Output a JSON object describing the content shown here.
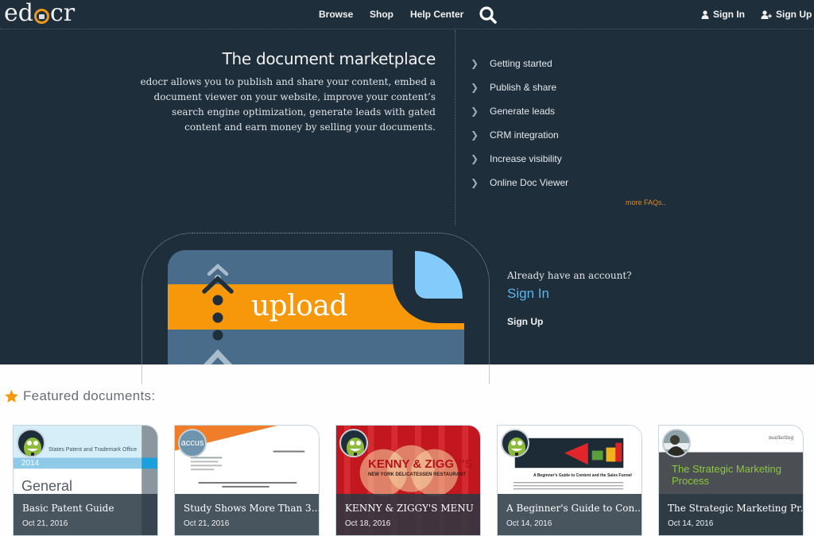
{
  "header": {
    "logo": {
      "prefix": "ed",
      "suffix": "cr"
    },
    "nav": [
      {
        "label": "Browse"
      },
      {
        "label": "Shop"
      },
      {
        "label": "Help Center"
      }
    ],
    "search_icon": "search-icon",
    "signin_label": "Sign In",
    "signup_label": "Sign Up"
  },
  "hero": {
    "headline": "The document marketplace",
    "description": "edocr allows you to publish and share your content, embed a document viewer on your website, improve your content’s search engine optimization, generate leads with gated content and earn money by selling your documents.",
    "faqs": [
      {
        "label": "Getting started"
      },
      {
        "label": "Publish & share"
      },
      {
        "label": "Generate leads"
      },
      {
        "label": "CRM integration"
      },
      {
        "label": "Increase visibility"
      },
      {
        "label": "Online Doc Viewer"
      }
    ],
    "more_faqs": "more FAQs..",
    "upload_label": "upload",
    "account": {
      "question": "Already have an account?",
      "signin": "Sign In",
      "signup": "Sign Up"
    }
  },
  "featured": {
    "title": "Featured documents:",
    "cards": [
      {
        "title": "Basic Patent Guide",
        "date": "Oct 21, 2016",
        "thumb_heading": "General",
        "thumb_year": "2014",
        "thumb_org": "States Patent and Trademark Office"
      },
      {
        "title": "Study Shows More Than 3...",
        "date": "Oct 21, 2016",
        "avatar_text": "accus"
      },
      {
        "title": "KENNY & ZIGGY'S MENU",
        "date": "Oct 18, 2016",
        "thumb_heading": "KENNY & ZIGGY'S",
        "thumb_sub": "NEW YORK DELICATESSEN RESTAURANT"
      },
      {
        "title": "A Beginner's Guide to Con...",
        "date": "Oct 14, 2016",
        "thumb_heading": "A Beginner's Guide to Content and the Sales Funnel"
      },
      {
        "title": "The Strategic Marketing Pr...",
        "date": "Oct 14, 2016",
        "thumb_heading": "The Strategic Marketing Process",
        "thumb_brand": "marketing"
      }
    ]
  },
  "colors": {
    "background_dark": "#1f2e3b",
    "accent_orange": "#f7980b",
    "link_blue": "#5ab6ef",
    "upload_blue": "#486c8a",
    "flap_blue": "#83cbfb"
  }
}
